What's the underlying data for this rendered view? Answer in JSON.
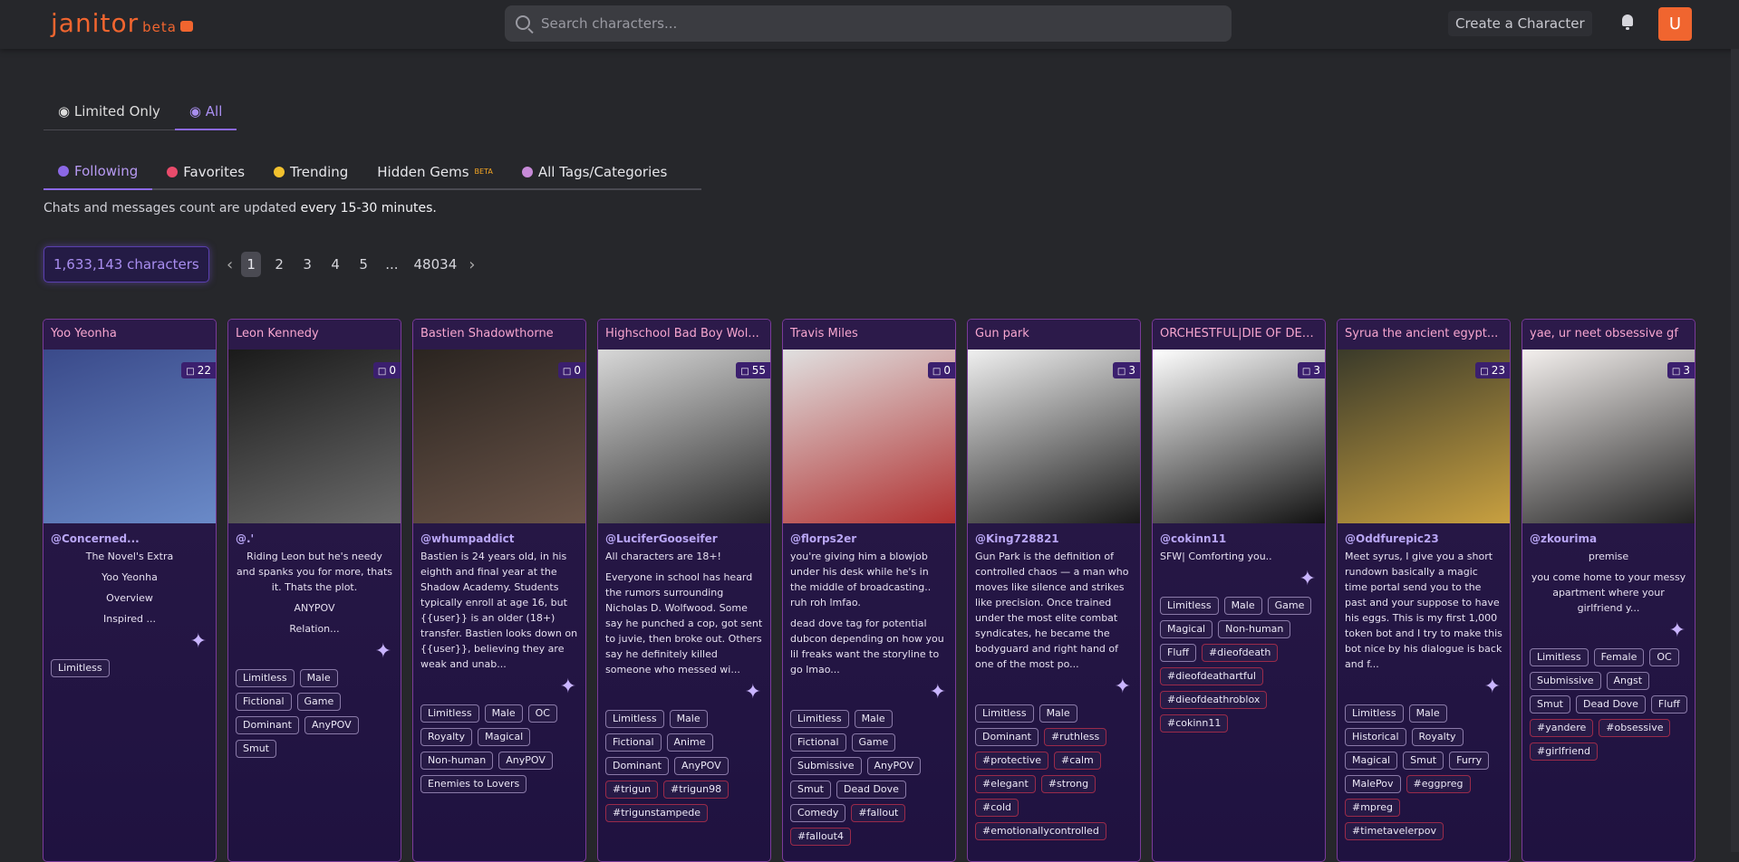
{
  "header": {
    "logo": "janitor",
    "logo_beta": "beta",
    "search_placeholder": "Search characters...",
    "create_label": "Create a Character",
    "avatar_letter": "U"
  },
  "filter_toggle": [
    {
      "label": "Limited Only",
      "active": false
    },
    {
      "label": "All",
      "active": true
    }
  ],
  "tabs": [
    {
      "label": "Following",
      "active": true,
      "icon_color": "#8b68e6"
    },
    {
      "label": "Favorites",
      "active": false,
      "icon_color": "#e94b6b"
    },
    {
      "label": "Trending",
      "active": false,
      "icon_color": "#f2c12e"
    },
    {
      "label": "Hidden Gems",
      "active": false,
      "badge": "BETA"
    },
    {
      "label": "All Tags/Categories",
      "active": false,
      "icon_color": "#c78ad8"
    }
  ],
  "note": {
    "prefix": "Chats and messages count are updated ",
    "emph": "every 15-30 minutes."
  },
  "character_count": "1,633,143 characters",
  "pagination": {
    "pages": [
      "1",
      "2",
      "3",
      "4",
      "5",
      "...",
      "48034"
    ],
    "current": "1"
  },
  "cards": [
    {
      "name": "Yoo Yeonha",
      "chats": "22",
      "creator": "@Concerned...",
      "desc_lines": [
        "The Novel's Extra",
        "Yoo Yeonha",
        "Overview",
        "Inspired ..."
      ],
      "tags": [
        "Limitless"
      ],
      "colors": [
        "#3a4a8a",
        "#6a8ac8"
      ]
    },
    {
      "name": "Leon Kennedy",
      "chats": "0",
      "creator": "@.'",
      "desc_lines": [
        "Riding Leon but he's needy and spanks you for more, thats it. Thats the plot.",
        "ANYPOV",
        "Relation..."
      ],
      "tags": [
        "Limitless",
        "Male",
        "Fictional",
        "Game",
        "Dominant",
        "AnyPOV",
        "Smut"
      ],
      "colors": [
        "#1a1a1a",
        "#6a6a6a"
      ]
    },
    {
      "name": "Bastien Shadowthorne",
      "chats": "0",
      "creator": "@whumpaddict",
      "desc_lines": [
        "Bastien is 24 years old, in his eighth and final year at the Shadow Academy. Students typically enroll at age 16, but {{user}} is an older (18+) transfer. Bastien looks down on {{user}}, believing they are weak and unab..."
      ],
      "tags": [
        "Limitless",
        "Male",
        "OC",
        "Royalty",
        "Magical",
        "Non-human",
        "AnyPOV",
        "Enemies to Lovers"
      ],
      "colors": [
        "#2a2420",
        "#6a5448"
      ]
    },
    {
      "name": "Highschool Bad Boy Wol...",
      "chats": "55",
      "creator": "@LuciferGooseifer",
      "desc_lines": [
        "All characters are 18+!",
        "Everyone in school has heard the rumors surrounding Nicholas D. Wolfwood. Some say he punched a cop, got sent to juvie, then broke out. Others say he definitely killed someone who messed wi..."
      ],
      "tags": [
        "Limitless",
        "Male",
        "Fictional",
        "Anime",
        "Dominant",
        "AnyPOV",
        "#trigun",
        "#trigun98",
        "#trigunstampede"
      ],
      "colors": [
        "#d8d8d8",
        "#2a2a2a"
      ]
    },
    {
      "name": "Travis Miles",
      "chats": "0",
      "creator": "@florps2er",
      "desc_lines": [
        "you're giving him a blowjob under his desk while he's in the middle of broadcasting.. ruh roh lmfao.",
        "dead dove tag for potential dubcon depending on how you lil freaks want the storyline to go lmao..."
      ],
      "tags": [
        "Limitless",
        "Male",
        "Fictional",
        "Game",
        "Submissive",
        "AnyPOV",
        "Smut",
        "Dead Dove",
        "Comedy",
        "#fallout",
        "#fallout4"
      ],
      "colors": [
        "#e0e0e0",
        "#b03030"
      ]
    },
    {
      "name": "Gun park",
      "chats": "3",
      "creator": "@King728821",
      "desc_lines": [
        "Gun Park is the definition of controlled chaos — a man who moves like silence and strikes like precision. Once trained under the most elite combat syndicates, he became the bodyguard and right hand of one of the most po..."
      ],
      "tags": [
        "Limitless",
        "Male",
        "Dominant",
        "#ruthless",
        "#protective",
        "#calm",
        "#elegant",
        "#strong",
        "#cold",
        "#emotionallycontrolled"
      ],
      "colors": [
        "#f0f0f0",
        "#1a1a1a"
      ]
    },
    {
      "name": "ORCHESTFUL|DIE OF DEA...",
      "chats": "3",
      "creator": "@cokinn11",
      "desc_lines": [
        "SFW| Comforting you.."
      ],
      "tags": [
        "Limitless",
        "Male",
        "Game",
        "Magical",
        "Non-human",
        "Fluff",
        "#dieofdeath",
        "#dieofdeathartful",
        "#dieofdeathroblox",
        "#cokinn11"
      ],
      "colors": [
        "#ffffff",
        "#111111"
      ]
    },
    {
      "name": "Syrua the ancient egypt...",
      "chats": "23",
      "creator": "@Oddfurepic23",
      "desc_lines": [
        "Meet syrus, I give you a short rundown basically a magic time portal send you to the past and your suppose to have his eggs. This is my first 1,000 token bot and I try to make this bot nice by his dialogue is back and f..."
      ],
      "tags": [
        "Limitless",
        "Male",
        "Historical",
        "Royalty",
        "Magical",
        "Smut",
        "Furry",
        "MalePov",
        "#eggpreg",
        "#mpreg",
        "#timetavelerpov"
      ],
      "colors": [
        "#3a3a2a",
        "#c8a040"
      ]
    },
    {
      "name": "yae, ur neet obsessive gf",
      "chats": "3",
      "creator": "@zkourima",
      "desc_lines": [
        "premise",
        "you come home to your messy apartment where your girlfriend y..."
      ],
      "tags": [
        "Limitless",
        "Female",
        "OC",
        "Submissive",
        "Angst",
        "Smut",
        "Dead Dove",
        "Fluff",
        "#yandere",
        "#obsessive",
        "#girlfriend"
      ],
      "colors": [
        "#f4f0ee",
        "#222222"
      ]
    }
  ]
}
